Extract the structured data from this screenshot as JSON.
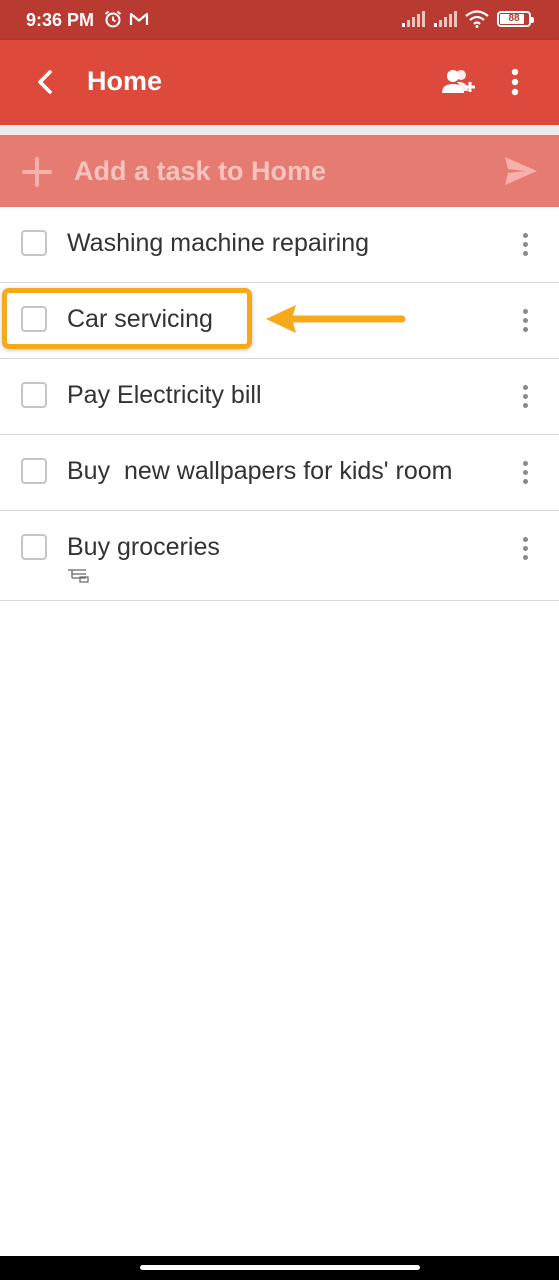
{
  "status_bar": {
    "time": "9:36 PM",
    "battery_level": "88",
    "battery_fraction": 0.88,
    "icons": [
      "alarm-icon",
      "gmail-icon",
      "signal-icon",
      "signal-icon",
      "wifi-icon",
      "battery-icon"
    ]
  },
  "app_bar": {
    "title": "Home",
    "color": "#dd4a3c",
    "icons": [
      "back-arrow-icon",
      "add-person-icon",
      "more-vertical-icon"
    ]
  },
  "add_task": {
    "placeholder": "Add a task to Home",
    "value": "",
    "icons": [
      "plus-icon",
      "send-icon"
    ]
  },
  "tasks": [
    {
      "label": "Washing machine repairing",
      "checked": false
    },
    {
      "label": "Car servicing",
      "checked": false,
      "highlighted": true
    },
    {
      "label": "Pay Electricity bill",
      "checked": false
    },
    {
      "label": "Buy  new wallpapers for kids' room",
      "checked": false
    },
    {
      "label": "Buy groceries",
      "checked": false,
      "has_subtasks": true
    }
  ],
  "annotation": {
    "highlight_color": "#f5a91b",
    "target_task": "Car servicing"
  }
}
